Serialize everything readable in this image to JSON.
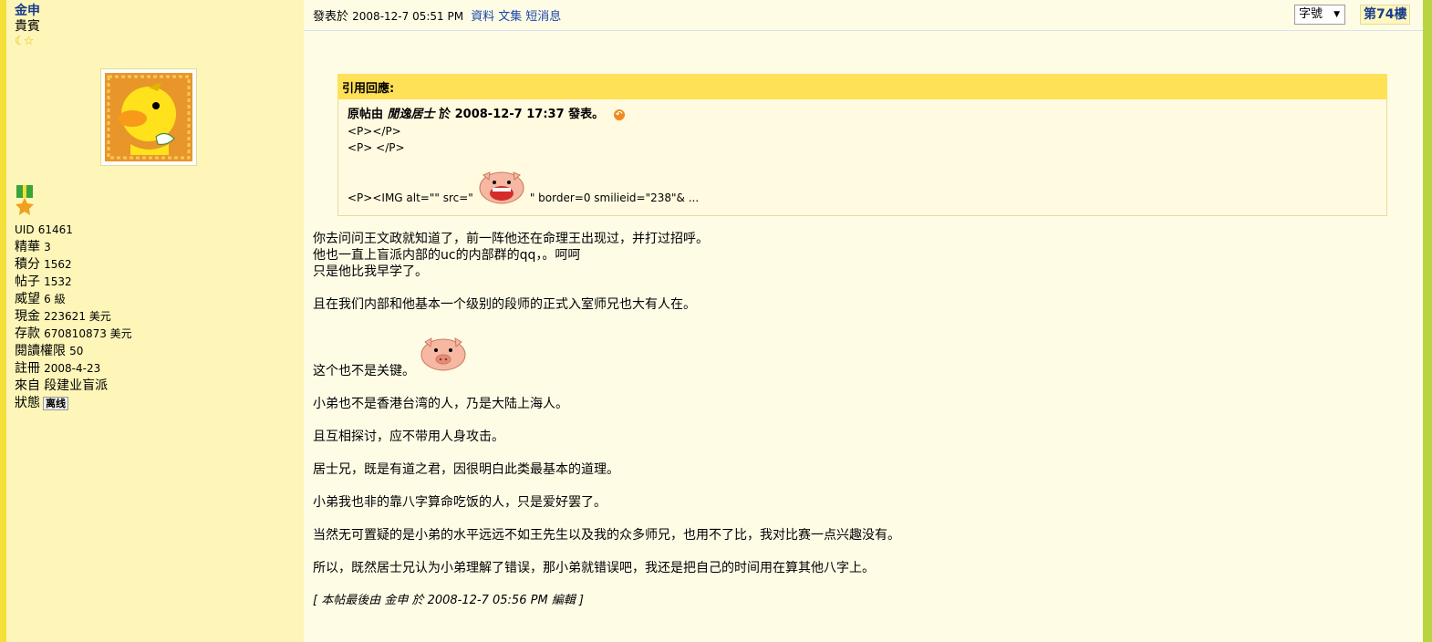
{
  "user": {
    "name": "金申",
    "group": "貴賓",
    "rank_stars": "☾☆",
    "stats": [
      {
        "k": "UID",
        "v": "61461"
      },
      {
        "k": "精華",
        "v": "3"
      },
      {
        "k": "積分",
        "v": "1562"
      },
      {
        "k": "帖子",
        "v": "1532"
      },
      {
        "k": "威望",
        "v": "6 級"
      },
      {
        "k": "現金",
        "v": "223621 美元"
      },
      {
        "k": "存款",
        "v": "670810873 美元"
      },
      {
        "k": "閱讀權限",
        "v": "50"
      },
      {
        "k": "註冊",
        "v": "2008-4-23"
      },
      {
        "k": "來自",
        "v": "段建业盲派"
      }
    ],
    "status_label": "狀態",
    "status_value": "离线"
  },
  "post": {
    "posted_prefix": "發表於",
    "posted_time": "2008-12-7 05:51 PM",
    "links": [
      "資料",
      "文集",
      "短消息"
    ],
    "font_select": "字號",
    "floor": "第74樓",
    "quote": {
      "header": "引用回應:",
      "orig_prefix": "原帖由",
      "orig_poster": "閒逸居士",
      "orig_mid": "於 2008-12-7 17:37 發表。",
      "lines": [
        "<P></P>",
        "<P> </P>"
      ],
      "img_prefix": "<P><IMG alt=\"\" src=\"",
      "img_suffix": "\" border=0 smilieid=\"238\"& ..."
    },
    "body": [
      "你去问问王文政就知道了，前一阵他还在命理王出现过，并打过招呼。",
      "他也一直上盲派内部的uc的内部群的qq，。呵呵",
      "只是他比我早学了。",
      "且在我们内部和他基本一个级别的段师的正式入室师兄也大有人在。",
      "这个也不是关键。",
      "小弟也不是香港台湾的人，乃是大陆上海人。",
      "且互相探讨，应不带用人身攻击。",
      "居士兄，既是有道之君，因很明白此类最基本的道理。",
      "小弟我也非的靠八字算命吃饭的人，只是爱好罢了。",
      "当然无可置疑的是小弟的水平远远不如王先生以及我的众多师兄，也用不了比，我对比赛一点兴趣没有。",
      "所以，既然居士兄认为小弟理解了错误，那小弟就错误吧，我还是把自己的时间用在算其他八字上。"
    ],
    "edited_note": "[ 本帖最後由 金申 於 2008-12-7 05:56 PM 編輯 ]"
  }
}
